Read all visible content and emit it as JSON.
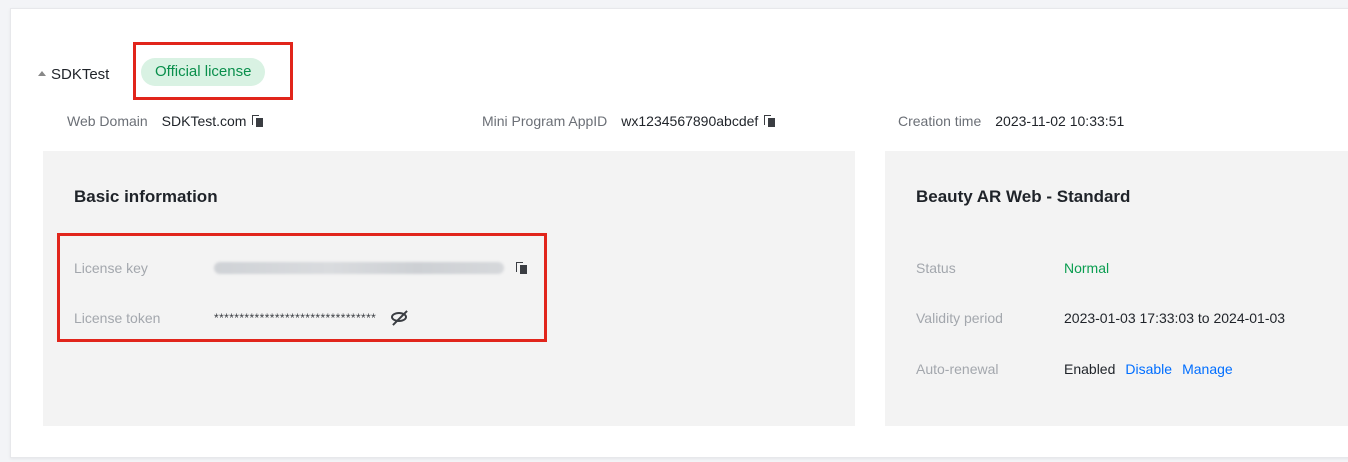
{
  "app": {
    "name": "SDKTest",
    "license_badge": "Official license"
  },
  "meta": {
    "web_domain": {
      "label": "Web Domain",
      "value": "SDKTest.com"
    },
    "appid": {
      "label": "Mini Program AppID",
      "value": "wx1234567890abcdef"
    },
    "creation": {
      "label": "Creation time",
      "value": "2023-11-02 10:33:51"
    }
  },
  "basic": {
    "title": "Basic information",
    "license_key_label": "License key",
    "license_token_label": "License token",
    "license_token_value": "********************************"
  },
  "plan": {
    "title": "Beauty AR Web - Standard",
    "status_label": "Status",
    "status_value": "Normal",
    "validity_label": "Validity period",
    "validity_value": "2023-01-03 17:33:03 to 2024-01-03",
    "renewal_label": "Auto-renewal",
    "renewal_value": "Enabled",
    "disable_link": "Disable",
    "manage_link": "Manage"
  },
  "colors": {
    "status_green": "#0a9d50",
    "link_blue": "#006eff",
    "highlight_red": "#e1251b"
  }
}
